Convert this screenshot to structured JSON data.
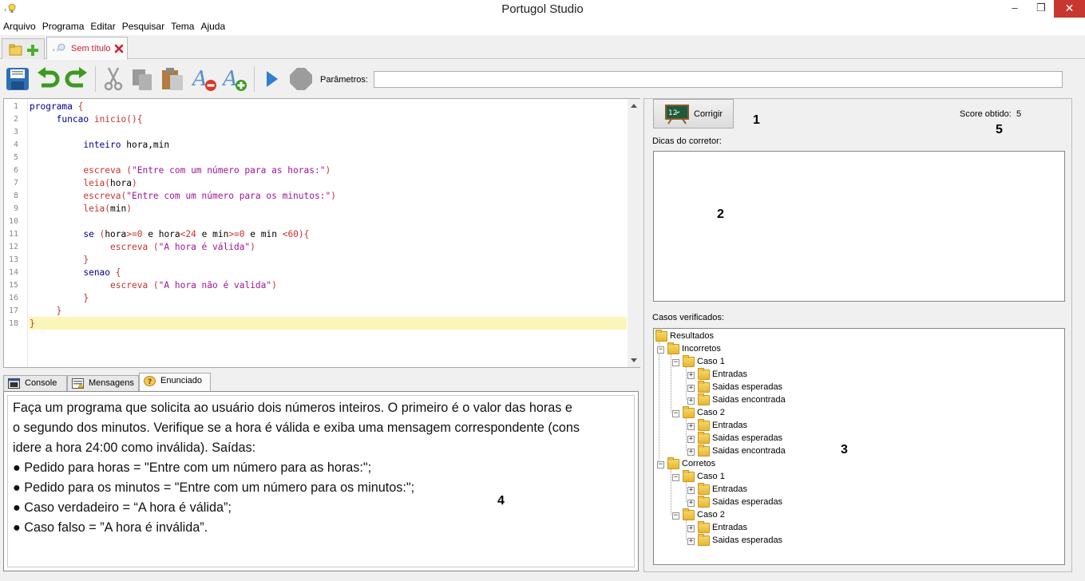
{
  "window": {
    "title": "Portugol Studio",
    "min_glyph": "–",
    "max_glyph": "❐",
    "close_glyph": "✕"
  },
  "menu": [
    "Arquivo",
    "Programa",
    "Editar",
    "Pesquisar",
    "Tema",
    "Ajuda"
  ],
  "tabs": {
    "file_tab_label": "Sem título"
  },
  "toolbar": {
    "params_label": "Parâmetros:",
    "params_value": "",
    "icons": [
      "save-icon",
      "undo-icon",
      "redo-icon",
      "cut-icon",
      "copy-icon",
      "paste-icon",
      "decrease-font-icon",
      "increase-font-icon",
      "run-icon",
      "stop-icon"
    ]
  },
  "editor": {
    "line_numbers": [
      "1",
      "2",
      "3",
      "4",
      "5",
      "6",
      "7",
      "8",
      "9",
      "10",
      "11",
      "12",
      "13",
      "14",
      "15",
      "16",
      "17",
      "18"
    ],
    "lines": [
      [
        {
          "t": "programa ",
          "c": "kw"
        },
        {
          "t": "{",
          "c": "fn"
        }
      ],
      [
        {
          "t": "     funcao ",
          "c": "kw"
        },
        {
          "t": "inicio(){",
          "c": "fn"
        }
      ],
      [
        {
          "t": "",
          "c": "pl"
        }
      ],
      [
        {
          "t": "          inteiro ",
          "c": "kw"
        },
        {
          "t": "hora,min",
          "c": "pl"
        }
      ],
      [
        {
          "t": "",
          "c": "pl"
        }
      ],
      [
        {
          "t": "          escreva (",
          "c": "fn"
        },
        {
          "t": "\"Entre com um número para as horas:\"",
          "c": "str"
        },
        {
          "t": ")",
          "c": "fn"
        }
      ],
      [
        {
          "t": "          leia(",
          "c": "fn"
        },
        {
          "t": "hora",
          "c": "pl"
        },
        {
          "t": ")",
          "c": "fn"
        }
      ],
      [
        {
          "t": "          escreva(",
          "c": "fn"
        },
        {
          "t": "\"Entre com um número para os minutos:\"",
          "c": "str"
        },
        {
          "t": ")",
          "c": "fn"
        }
      ],
      [
        {
          "t": "          leia(",
          "c": "fn"
        },
        {
          "t": "min",
          "c": "pl"
        },
        {
          "t": ")",
          "c": "fn"
        }
      ],
      [
        {
          "t": "",
          "c": "pl"
        }
      ],
      [
        {
          "t": "          se ",
          "c": "kw"
        },
        {
          "t": "(",
          "c": "fn"
        },
        {
          "t": "hora",
          "c": "pl"
        },
        {
          "t": ">=0 ",
          "c": "fn"
        },
        {
          "t": "e ",
          "c": "pl"
        },
        {
          "t": "hora",
          "c": "pl"
        },
        {
          "t": "<24 ",
          "c": "fn"
        },
        {
          "t": "e ",
          "c": "pl"
        },
        {
          "t": "min",
          "c": "pl"
        },
        {
          "t": ">=0 ",
          "c": "fn"
        },
        {
          "t": "e ",
          "c": "pl"
        },
        {
          "t": "min ",
          "c": "pl"
        },
        {
          "t": "<60){",
          "c": "fn"
        }
      ],
      [
        {
          "t": "               escreva (",
          "c": "fn"
        },
        {
          "t": "\"A hora é válida\"",
          "c": "str"
        },
        {
          "t": ")",
          "c": "fn"
        }
      ],
      [
        {
          "t": "          }",
          "c": "fn"
        }
      ],
      [
        {
          "t": "          senao ",
          "c": "kw"
        },
        {
          "t": "{",
          "c": "fn"
        }
      ],
      [
        {
          "t": "               escreva (",
          "c": "fn"
        },
        {
          "t": "\"A hora não é valida\"",
          "c": "str"
        },
        {
          "t": ")",
          "c": "fn"
        }
      ],
      [
        {
          "t": "          }",
          "c": "fn"
        }
      ],
      [
        {
          "t": "     }",
          "c": "fn"
        }
      ],
      [
        {
          "t": "}",
          "c": "fn"
        }
      ]
    ]
  },
  "bottom_tabs": [
    "Console",
    "Mensagens",
    "Enunciado"
  ],
  "enunciado": {
    "text_lines": [
      "Faça um programa que solicita ao usuário dois números inteiros. O primeiro é o valor das horas e",
      "o segundo dos minutos. Verifique se a hora é válida e exiba uma mensagem correspondente (cons",
      "idere a hora 24:00 como inválida). Saídas:",
      "● Pedido para horas  = \"Entre com um número para as horas:\";",
      "● Pedido para os minutos = \"Entre com um número para os minutos:\";",
      "● Caso verdadeiro = “A hora é válida”;",
      "● Caso falso = ”A hora é inválida”."
    ]
  },
  "right_panel": {
    "corrigir_label": "Corrigir",
    "score_label": "Score obtido:",
    "score_value": "5",
    "dicas_label": "Dicas do corretor:",
    "casos_label": "Casos verificados:",
    "tree": [
      {
        "label": "Resultados",
        "depth": 0,
        "exp": false
      },
      {
        "label": "Incorretos",
        "depth": 1,
        "exp": "-"
      },
      {
        "label": "Caso 1",
        "depth": 2,
        "exp": "-"
      },
      {
        "label": "Entradas",
        "depth": 3,
        "exp": "+"
      },
      {
        "label": "Saidas esperadas",
        "depth": 3,
        "exp": "+"
      },
      {
        "label": "Saidas encontrada",
        "depth": 3,
        "exp": "+"
      },
      {
        "label": "Caso 2",
        "depth": 2,
        "exp": "-"
      },
      {
        "label": "Entradas",
        "depth": 3,
        "exp": "+"
      },
      {
        "label": "Saidas esperadas",
        "depth": 3,
        "exp": "+"
      },
      {
        "label": "Saidas encontrada",
        "depth": 3,
        "exp": "+"
      },
      {
        "label": "Corretos",
        "depth": 1,
        "exp": "-"
      },
      {
        "label": "Caso 1",
        "depth": 2,
        "exp": "-"
      },
      {
        "label": "Entradas",
        "depth": 3,
        "exp": "+"
      },
      {
        "label": "Saidas esperadas",
        "depth": 3,
        "exp": "+"
      },
      {
        "label": "Caso 2",
        "depth": 2,
        "exp": "-"
      },
      {
        "label": "Entradas",
        "depth": 3,
        "exp": "+"
      },
      {
        "label": "Saidas esperadas",
        "depth": 3,
        "exp": "+"
      }
    ]
  },
  "annotations": {
    "m1": "1",
    "m2": "2",
    "m3": "3",
    "m4": "4",
    "m5": "5"
  }
}
